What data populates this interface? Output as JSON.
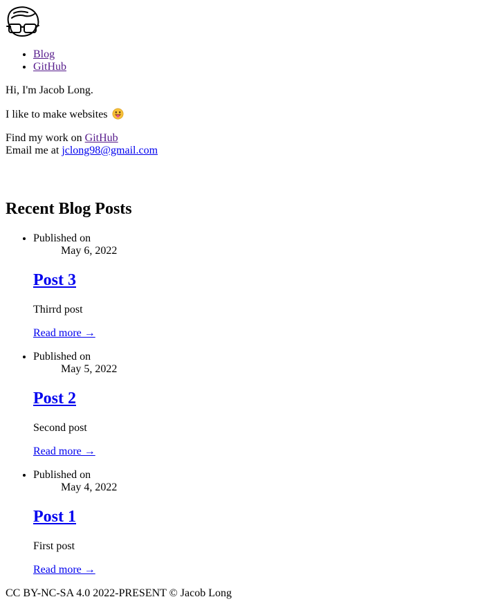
{
  "header": {
    "logo_alt": "Jacob Long avatar",
    "nav": [
      {
        "label": "Blog"
      },
      {
        "label": "GitHub"
      }
    ]
  },
  "intro": {
    "greeting": "Hi, I'm Jacob Long.",
    "tagline": "I like to make websites",
    "tagline_emoji": "grinning-tongue-emoji",
    "work_prefix": "Find my work on ",
    "work_link": "GitHub",
    "email_prefix": "Email me at ",
    "email_link": "jclong98@gmail.com"
  },
  "blog": {
    "heading": "Recent Blog Posts",
    "published_label": "Published on",
    "read_more": "Read more →",
    "posts": [
      {
        "date": "May 6, 2022",
        "title": "Post 3",
        "description": "Thirrd post"
      },
      {
        "date": "May 5, 2022",
        "title": "Post 2",
        "description": "Second post"
      },
      {
        "date": "May 4, 2022",
        "title": "Post 1",
        "description": "First post"
      }
    ]
  },
  "footer": {
    "text": "CC BY-NC-SA 4.0 2022-PRESENT © Jacob Long"
  },
  "colors": {
    "link": "#0000ee",
    "visited_link": "#551a8b"
  }
}
